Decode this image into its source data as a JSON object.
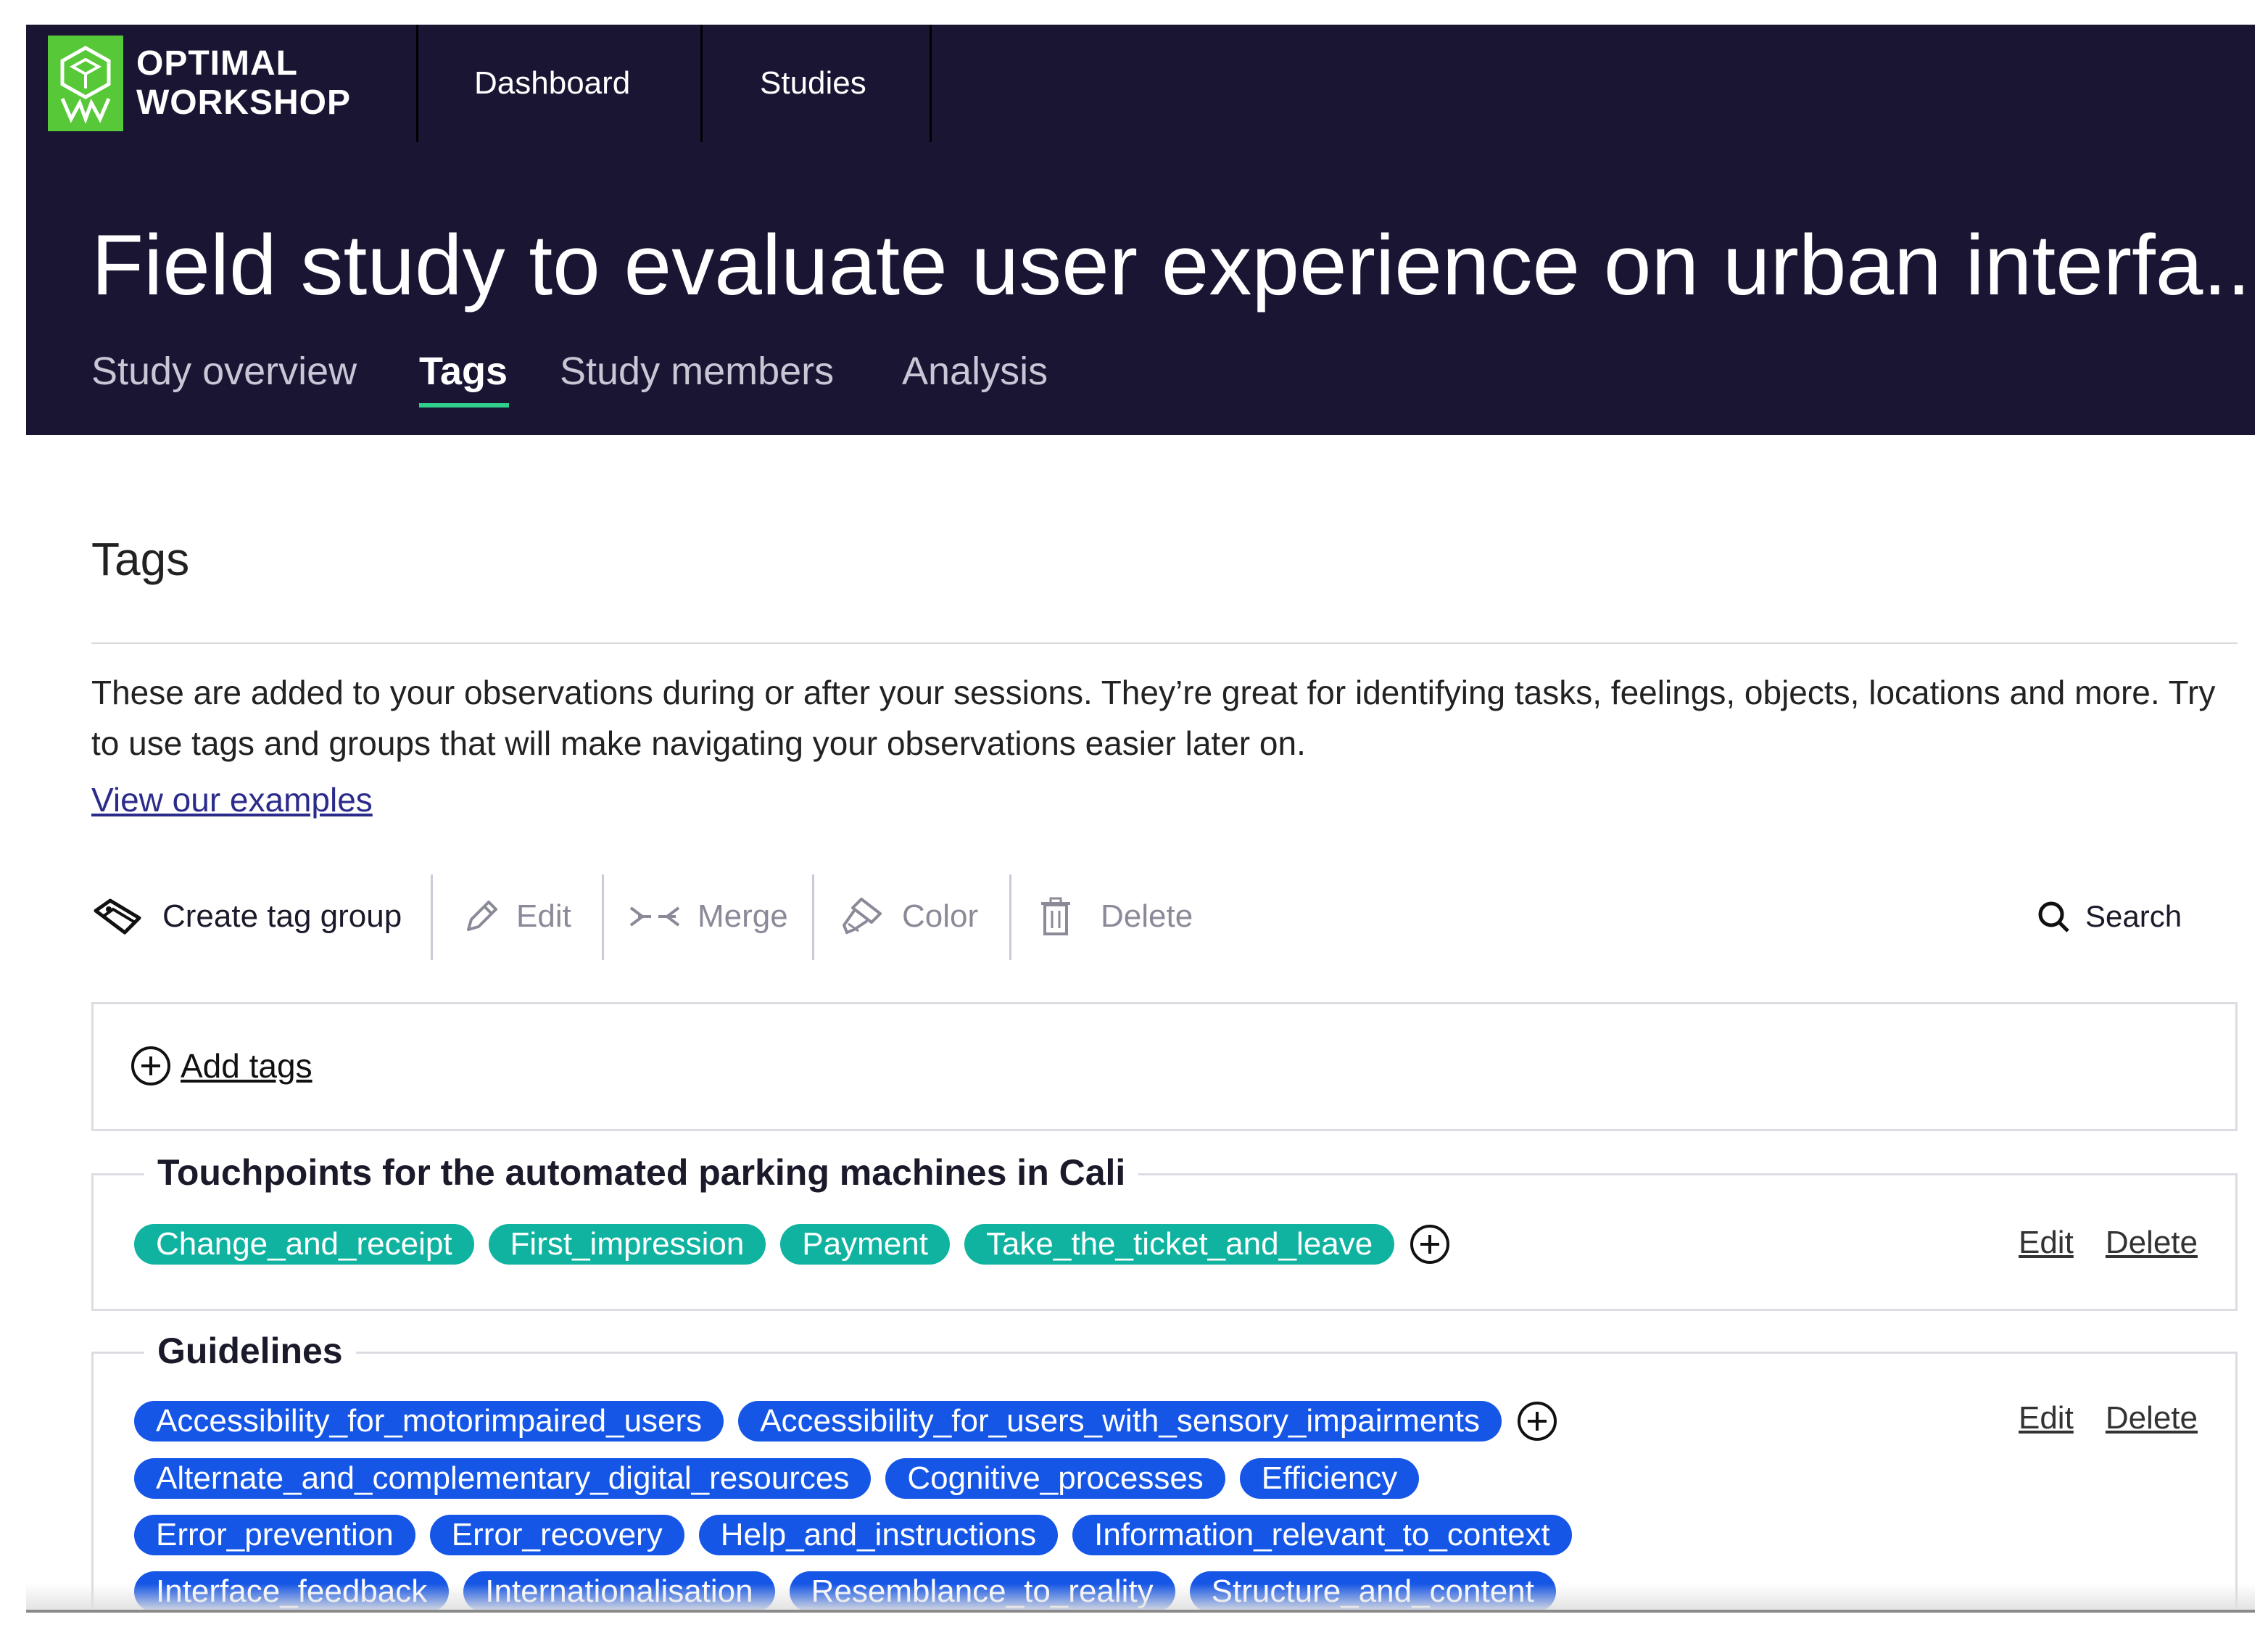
{
  "brand": {
    "logo_line1": "OPTIMAL",
    "logo_line2": "WORKSHOP",
    "logo_color": "#57c837"
  },
  "nav": {
    "items": [
      "Dashboard",
      "Studies"
    ]
  },
  "study": {
    "title": "Field study to evaluate user experience on urban interfa...",
    "tabs": [
      "Study overview",
      "Tags",
      "Study members",
      "Analysis"
    ],
    "active_tab": "Tags"
  },
  "page": {
    "heading": "Tags",
    "description": "These are added to your observations during or after your sessions. They’re great for identifying tasks, feelings, objects, locations and more. Try to use tags and groups that will make navigating your observations easier later on.",
    "examples_link": "View our examples"
  },
  "toolbar": {
    "create": "Create tag group",
    "edit": "Edit",
    "merge": "Merge",
    "color": "Color",
    "delete": "Delete",
    "search": "Search"
  },
  "add_tags": {
    "label": "Add tags"
  },
  "groups": [
    {
      "title": "Touchpoints for the automated parking machines in Cali",
      "color": "#10b3a0",
      "tags": [
        "Change_and_receipt",
        "First_impression",
        "Payment",
        "Take_the_ticket_and_leave"
      ],
      "edit": "Edit",
      "delete": "Delete"
    },
    {
      "title": "Guidelines",
      "color": "#1556e6",
      "tags": [
        "Accessibility_for_motorimpaired_users",
        "Accessibility_for_users_with_sensory_impairments",
        "Alternate_and_complementary_digital_resources",
        "Cognitive_processes",
        "Efficiency",
        "Error_prevention",
        "Error_recovery",
        "Help_and_instructions",
        "Information_relevant_to_context",
        "Interface_feedback",
        "Internationalisation",
        "Resemblance_to_reality",
        "Structure_and_content"
      ],
      "edit": "Edit",
      "delete": "Delete"
    }
  ]
}
